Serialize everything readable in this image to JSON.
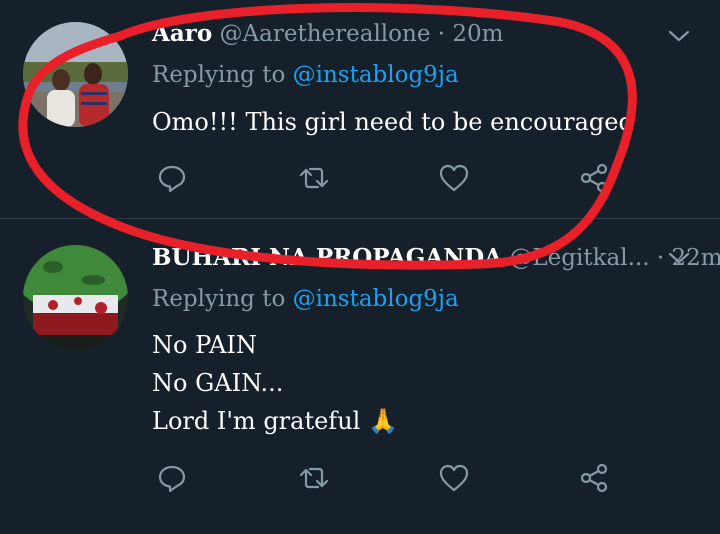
{
  "tweets": [
    {
      "name": "Aaro",
      "handle": "@Aarethereallone",
      "separator": "·",
      "time": "20m",
      "replying_prefix": "Replying to",
      "replying_to": "@instablog9ja",
      "lines": [
        "Omo!!! This girl need to be encouraged"
      ]
    },
    {
      "name": "BUHARI NA PROPAGANDA",
      "handle": "@Legitkal...",
      "separator": "·",
      "time": "22m",
      "replying_prefix": "Replying to",
      "replying_to": "@instablog9ja",
      "lines": [
        "No PAIN",
        "No GAIN...",
        "Lord I'm grateful 🙏"
      ]
    }
  ],
  "icons": [
    "chevron-down-icon",
    "reply-icon",
    "retweet-icon",
    "like-icon",
    "share-icon"
  ],
  "colors": {
    "background": "#15202b",
    "muted": "#8899a6",
    "link": "#1da1f2",
    "annotation": "#e8202a"
  }
}
